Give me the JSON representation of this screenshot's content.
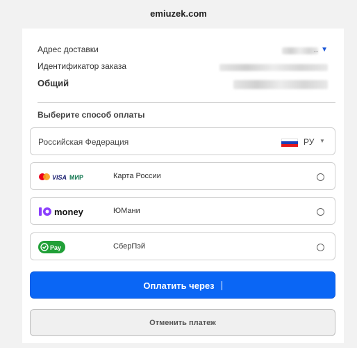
{
  "header": {
    "site_name": "emiuzek.com"
  },
  "summary": {
    "delivery_address_label": "Адрес доставки",
    "delivery_address_suffix": "..",
    "order_id_label": "Идентификатор заказа",
    "total_label": "Общий"
  },
  "payment": {
    "section_title": "Выберите способ оплаты",
    "country": {
      "name": "Российская Федерация",
      "code": "РУ"
    },
    "methods": [
      {
        "name": "Карта России",
        "logo": "visa-mir-mastercard-logo"
      },
      {
        "name": "ЮМани",
        "logo": "yoomoney-logo",
        "logo_text": "money"
      },
      {
        "name": "СберПэй",
        "logo": "sberpay-logo",
        "logo_text": "Pay"
      }
    ],
    "submit_label": "Оплатить через",
    "cancel_label": "Отменить платеж"
  },
  "colors": {
    "primary": "#0a66f5",
    "sber_green": "#21a038",
    "yoomoney_purple": "#8b3ffd"
  }
}
